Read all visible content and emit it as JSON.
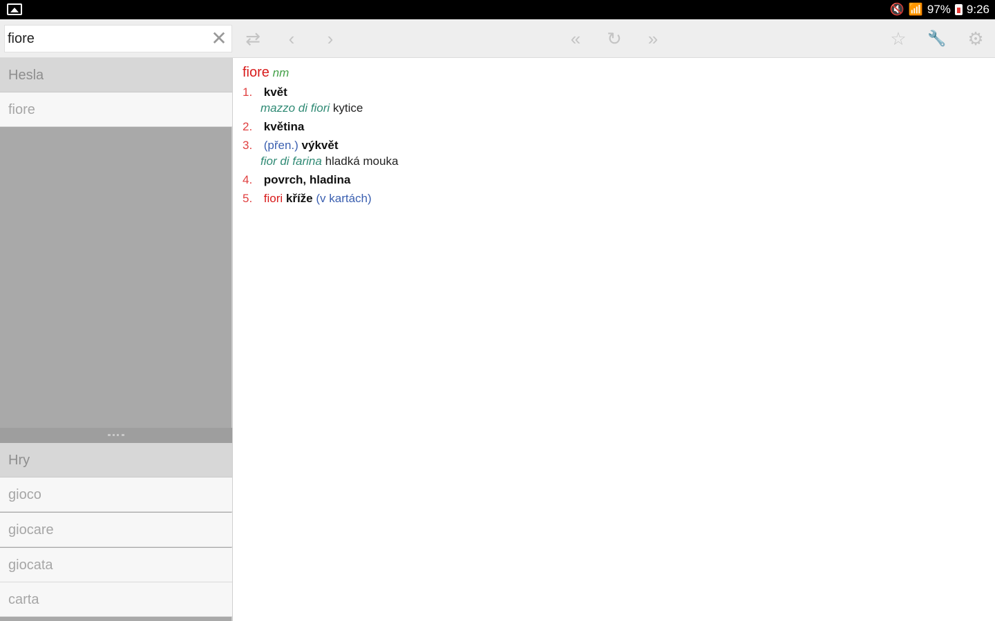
{
  "status_bar": {
    "battery": "97%",
    "time": "9:26"
  },
  "search": {
    "value": "fiore",
    "clear_label": "✕"
  },
  "toolbar": {
    "swap_icon": "⇄",
    "back_icon": "‹",
    "forward_icon": "›",
    "first_icon": "«",
    "refresh_icon": "↻",
    "last_icon": "»",
    "star_icon": "☆",
    "tools_icon": "🔧",
    "settings_icon": "⚙"
  },
  "left_panel": {
    "headwords_header": "Hesla",
    "headwords": [
      "fiore"
    ],
    "games_header": "Hry",
    "games": [
      "gioco",
      "giocare",
      "giocata",
      "carta"
    ]
  },
  "entry": {
    "headword": "fiore",
    "pos": "nm",
    "senses": [
      {
        "num": "1.",
        "translation": "květ",
        "example_it": "mazzo di fiori",
        "example_cs": "kytice"
      },
      {
        "num": "2.",
        "translation": "květina"
      },
      {
        "num": "3.",
        "note": "(přen.)",
        "translation": "výkvět",
        "example_it": "fior di farina",
        "example_cs": "hladká mouka"
      },
      {
        "num": "4.",
        "translation": "povrch, hladina"
      },
      {
        "num": "5.",
        "it": "fiori",
        "translation": "kříže",
        "note": "(v kartách)"
      }
    ]
  },
  "colors": {
    "headword": "#d81b1b",
    "pos": "#43a047",
    "example": "#2f8a74",
    "note": "#3a5fb0"
  }
}
